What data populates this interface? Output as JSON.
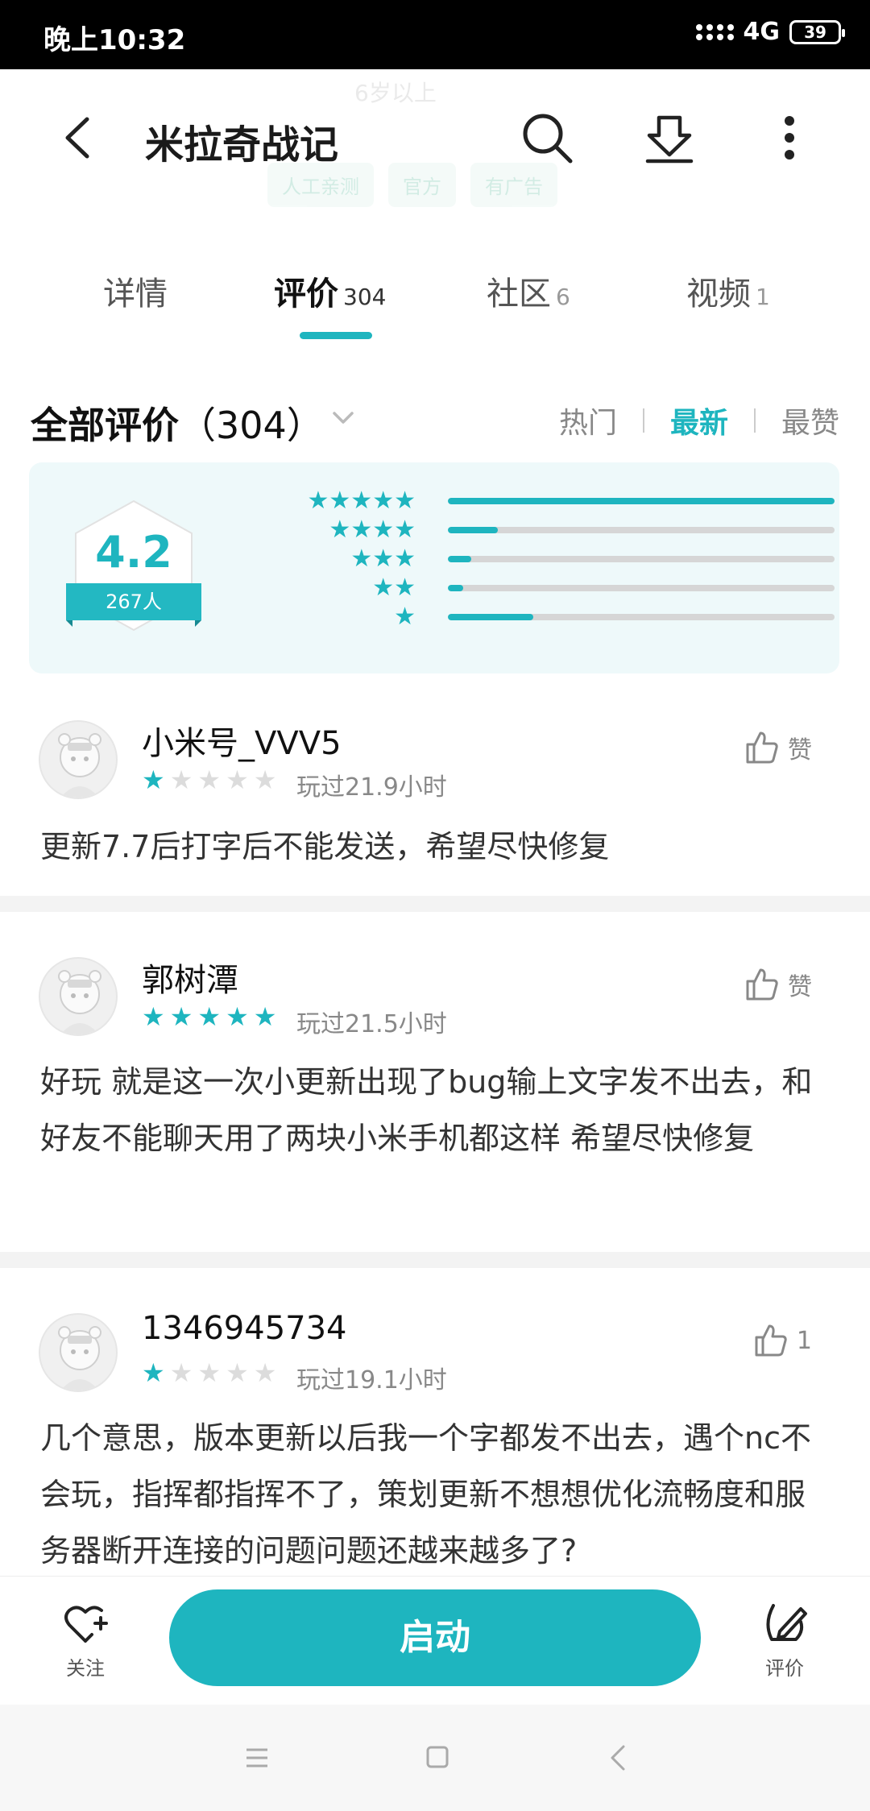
{
  "status_bar": {
    "time": "晚上10:32",
    "network": "4G",
    "battery": "39"
  },
  "header": {
    "title": "米拉奇战记",
    "ghost_age": "6岁以上",
    "ghost_tags": [
      "人工亲测",
      "官方",
      "有广告"
    ]
  },
  "tabs": [
    {
      "label": "详情",
      "count": ""
    },
    {
      "label": "评价",
      "count": "304"
    },
    {
      "label": "社区",
      "count": "6"
    },
    {
      "label": "视频",
      "count": "1"
    }
  ],
  "section": {
    "title": "全部评价",
    "count": "（304）",
    "sort_options": [
      "热门",
      "最新",
      "最赞"
    ],
    "active_sort": "最新"
  },
  "rating": {
    "score": "4.2",
    "raters": "267人",
    "distribution": [
      {
        "stars": 5,
        "fraction": 1.0
      },
      {
        "stars": 4,
        "fraction": 0.13
      },
      {
        "stars": 3,
        "fraction": 0.06
      },
      {
        "stars": 2,
        "fraction": 0.04
      },
      {
        "stars": 1,
        "fraction": 0.22
      }
    ]
  },
  "reviews": [
    {
      "user": "小米号_VVV5",
      "stars": 1,
      "played": "玩过21.9小时",
      "like_label": "赞",
      "text": "更新7.7后打字后不能发送，希望尽快修复"
    },
    {
      "user": "郭树潭",
      "stars": 5,
      "played": "玩过21.5小时",
      "like_label": "赞",
      "text": "好玩 就是这一次小更新出现了bug输上文字发不出去，和好友不能聊天用了两块小米手机都这样 希望尽快修复"
    },
    {
      "user": "1346945734",
      "stars": 1,
      "played": "玩过19.1小时",
      "like_label": "1",
      "text": "几个意思，版本更新以后我一个字都发不出去，遇个nc不会玩，指挥都指挥不了，策划更新不想想优化流畅度和服务器断开连接的问题问题还越来越多了?"
    }
  ],
  "action_bar": {
    "follow_label": "关注",
    "launch_label": "启动",
    "review_label": "评价"
  },
  "colors": {
    "accent": "#1eb5bf",
    "status_bar": "#000000"
  }
}
